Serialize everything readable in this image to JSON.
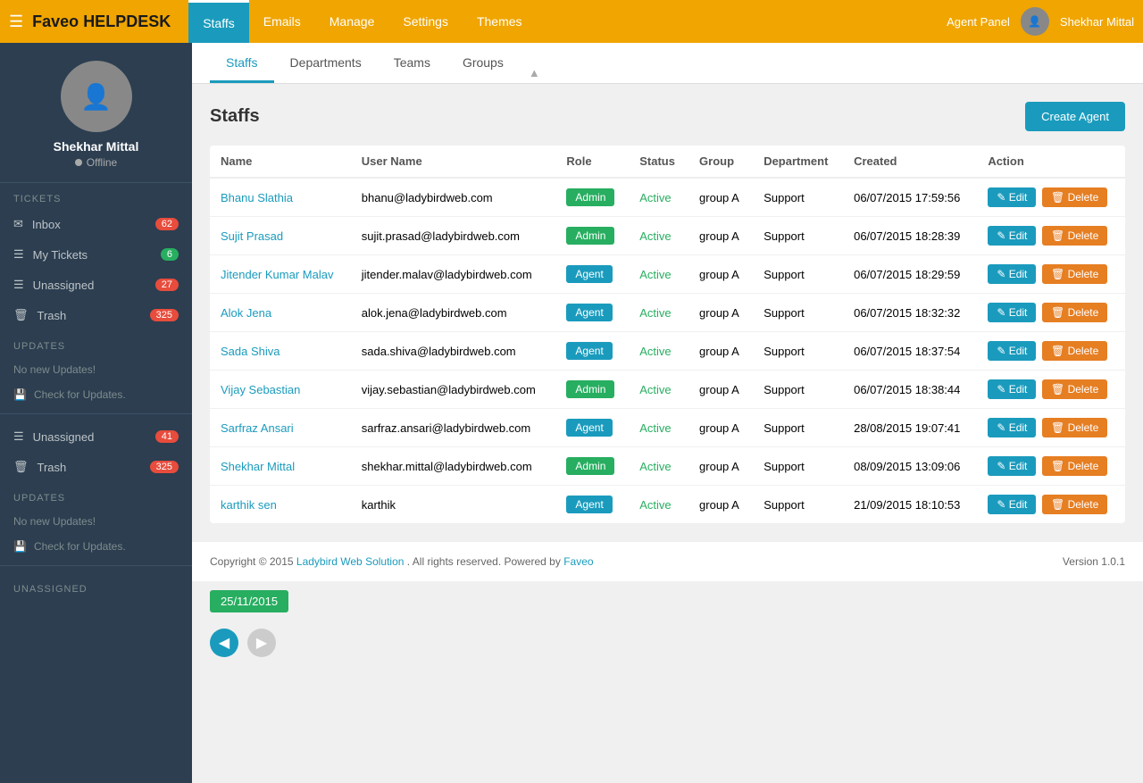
{
  "brand": {
    "name_part1": "Faveo",
    "name_part2": "HELPDESK"
  },
  "topnav": {
    "menu_icon": "☰",
    "links": [
      {
        "label": "Staffs",
        "active": true
      },
      {
        "label": "Emails",
        "active": false
      },
      {
        "label": "Manage",
        "active": false
      },
      {
        "label": "Settings",
        "active": false
      },
      {
        "label": "Themes",
        "active": false
      }
    ],
    "agent_panel": "Agent Panel",
    "user_name": "Shekhar Mittal"
  },
  "sidebar": {
    "user": {
      "name": "Shekhar Mittal",
      "status": "Offline"
    },
    "tickets_section": "TICKETS",
    "inbox": {
      "label": "Inbox",
      "count": "62"
    },
    "my_tickets": {
      "label": "My Tickets",
      "count": "6"
    },
    "unassigned": {
      "label": "Unassigned",
      "count": "27"
    },
    "trash": {
      "label": "Trash",
      "count": "325"
    },
    "updates_section": "UPDATES",
    "no_updates": "No new Updates!",
    "check_updates": "Check for Updates.",
    "unassigned2": {
      "label": "Unassigned",
      "count": "41"
    },
    "trash2": {
      "label": "Trash",
      "count": "325"
    },
    "updates_section2": "UPDATES",
    "no_updates2": "No new Updates!",
    "check_updates2": "Check for Updates.",
    "unassigned_footer": "UNASSIGNED"
  },
  "tabs": {
    "items": [
      {
        "label": "Staffs",
        "active": true
      },
      {
        "label": "Departments",
        "active": false
      },
      {
        "label": "Teams",
        "active": false
      },
      {
        "label": "Groups",
        "active": false
      }
    ]
  },
  "page": {
    "title": "Staffs",
    "create_btn": "Create Agent"
  },
  "table": {
    "headers": [
      "Name",
      "User Name",
      "Role",
      "Status",
      "Group",
      "Department",
      "Created",
      "Action"
    ],
    "rows": [
      {
        "name": "Bhanu Slathia",
        "username": "bhanu@ladybirdweb.com",
        "role": "Admin",
        "role_type": "admin",
        "status": "Active",
        "group": "group A",
        "department": "Support",
        "created": "06/07/2015 17:59:56"
      },
      {
        "name": "Sujit Prasad",
        "username": "sujit.prasad@ladybirdweb.com",
        "role": "Admin",
        "role_type": "admin",
        "status": "Active",
        "group": "group A",
        "department": "Support",
        "created": "06/07/2015 18:28:39"
      },
      {
        "name": "Jitender Kumar Malav",
        "username": "jitender.malav@ladybirdweb.com",
        "role": "Agent",
        "role_type": "agent",
        "status": "Active",
        "group": "group A",
        "department": "Support",
        "created": "06/07/2015 18:29:59"
      },
      {
        "name": "Alok Jena",
        "username": "alok.jena@ladybirdweb.com",
        "role": "Agent",
        "role_type": "agent",
        "status": "Active",
        "group": "group A",
        "department": "Support",
        "created": "06/07/2015 18:32:32"
      },
      {
        "name": "Sada Shiva",
        "username": "sada.shiva@ladybirdweb.com",
        "role": "Agent",
        "role_type": "agent",
        "status": "Active",
        "group": "group A",
        "department": "Support",
        "created": "06/07/2015 18:37:54"
      },
      {
        "name": "Vijay Sebastian",
        "username": "vijay.sebastian@ladybirdweb.com",
        "role": "Admin",
        "role_type": "admin",
        "status": "Active",
        "group": "group A",
        "department": "Support",
        "created": "06/07/2015 18:38:44"
      },
      {
        "name": "Sarfraz Ansari",
        "username": "sarfraz.ansari@ladybirdweb.com",
        "role": "Agent",
        "role_type": "agent",
        "status": "Active",
        "group": "group A",
        "department": "Support",
        "created": "28/08/2015 19:07:41"
      },
      {
        "name": "Shekhar Mittal",
        "username": "shekhar.mittal@ladybirdweb.com",
        "role": "Admin",
        "role_type": "admin",
        "status": "Active",
        "group": "group A",
        "department": "Support",
        "created": "08/09/2015 13:09:06"
      },
      {
        "name": "karthik sen",
        "username": "karthik",
        "role": "Agent",
        "role_type": "agent",
        "status": "Active",
        "group": "group A",
        "department": "Support",
        "created": "21/09/2015 18:10:53"
      }
    ]
  },
  "footer": {
    "copyright": "Copyright © 2015",
    "company_link": "Ladybird Web Solution",
    "rights": ". All rights reserved. Powered by",
    "faveo_link": "Faveo",
    "version_label": "Version",
    "version_num": "1.0.1"
  },
  "date_badge": "25/11/2015",
  "action_edit": "✎ Edit",
  "action_delete": "🗑 Delete",
  "icons": {
    "inbox": "✉",
    "my_tickets": "☰",
    "unassigned": "☰",
    "trash": "🗑",
    "check_updates": "💾",
    "pencil": "✎",
    "trash_icon": "🗑"
  }
}
